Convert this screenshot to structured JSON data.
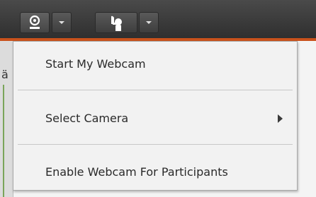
{
  "toolbar": {
    "webcam_button_icon": "webcam-icon",
    "status_button_icon": "raise-hand-icon",
    "dropdown_icon": "chevron-down-icon",
    "accent_color": "#c9521c"
  },
  "background": {
    "partial_text": "ä"
  },
  "menu": {
    "items": [
      {
        "label": "Start My Webcam"
      },
      {
        "label": "Select Camera",
        "has_submenu": true
      },
      {
        "label": "Enable Webcam For Participants"
      }
    ]
  }
}
